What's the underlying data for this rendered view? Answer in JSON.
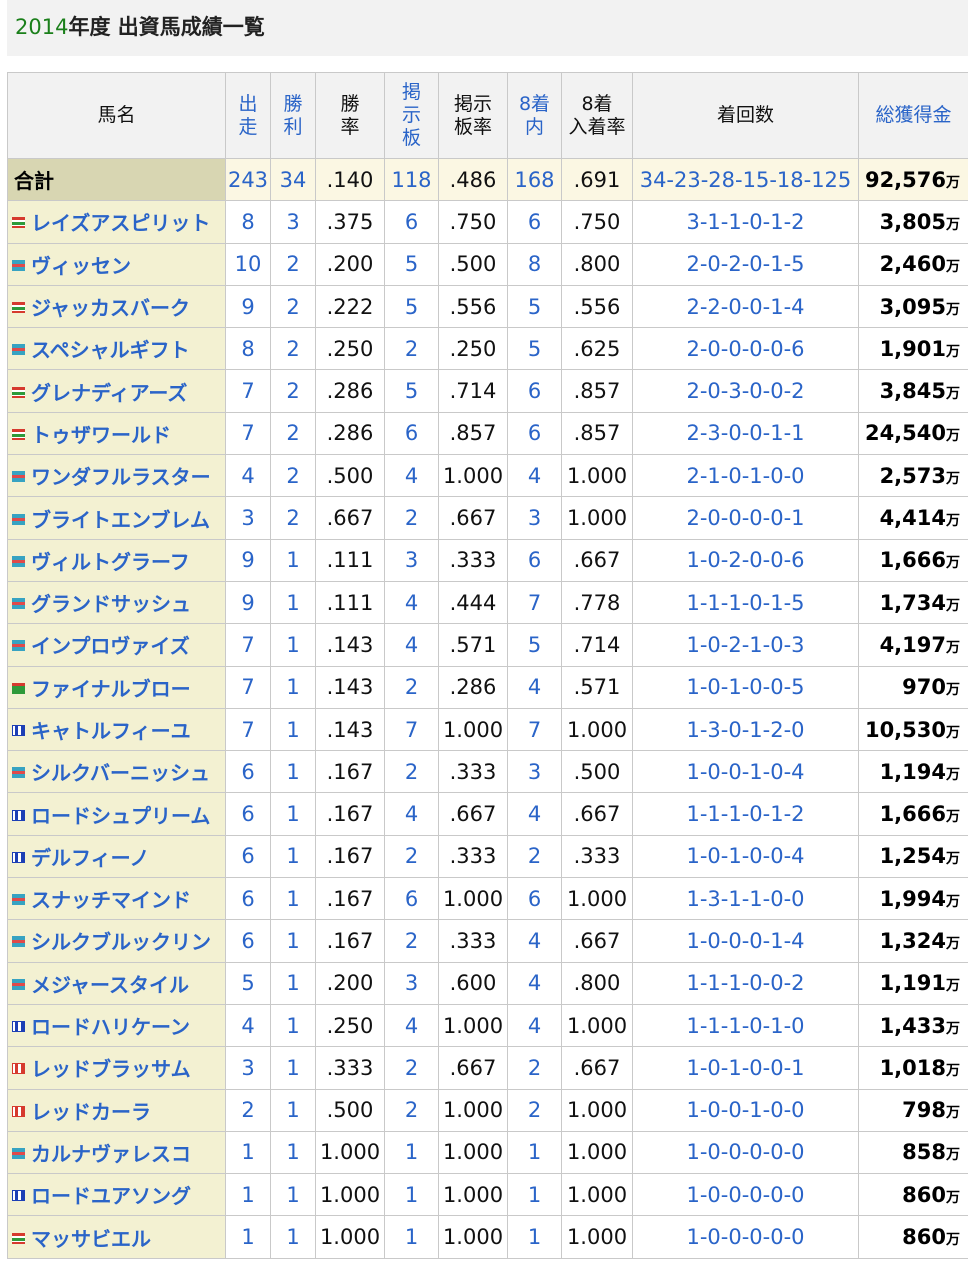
{
  "page": {
    "title_year": "2014",
    "title_rest": "年度 出資馬成績一覧"
  },
  "table": {
    "headers": {
      "name": "馬名",
      "starts": "出\n走",
      "wins": "勝\n利",
      "win_rate": "勝\n率",
      "board": "掲\n示\n板",
      "board_rate": "掲示\n板率",
      "top8": "8着\n内",
      "top8_rate": "8着\n入着率",
      "finishes": "着回数",
      "earnings": "総獲得金"
    },
    "unit": "万",
    "total": {
      "name": "合計",
      "starts": "243",
      "wins": "34",
      "win_rate": ".140",
      "board": "118",
      "board_rate": ".486",
      "top8": "168",
      "top8_rate": ".691",
      "finishes": "34-23-28-15-18-125",
      "earnings": "92,576"
    },
    "rows": [
      {
        "flag": "green-red",
        "name": "レイズアスピリット",
        "starts": "8",
        "wins": "3",
        "win_rate": ".375",
        "board": "6",
        "board_rate": ".750",
        "top8": "6",
        "top8_rate": ".750",
        "finishes": "3-1-1-0-1-2",
        "earnings": "3,805"
      },
      {
        "flag": "teal-red",
        "name": "ヴィッセン",
        "starts": "10",
        "wins": "2",
        "win_rate": ".200",
        "board": "5",
        "board_rate": ".500",
        "top8": "8",
        "top8_rate": ".800",
        "finishes": "2-0-2-0-1-5",
        "earnings": "2,460"
      },
      {
        "flag": "green-red",
        "name": "ジャッカスバーク",
        "starts": "9",
        "wins": "2",
        "win_rate": ".222",
        "board": "5",
        "board_rate": ".556",
        "top8": "5",
        "top8_rate": ".556",
        "finishes": "2-2-0-0-1-4",
        "earnings": "3,095"
      },
      {
        "flag": "teal-red",
        "name": "スペシャルギフト",
        "starts": "8",
        "wins": "2",
        "win_rate": ".250",
        "board": "2",
        "board_rate": ".250",
        "top8": "5",
        "top8_rate": ".625",
        "finishes": "2-0-0-0-0-6",
        "earnings": "1,901"
      },
      {
        "flag": "green-red",
        "name": "グレナディアーズ",
        "starts": "7",
        "wins": "2",
        "win_rate": ".286",
        "board": "5",
        "board_rate": ".714",
        "top8": "6",
        "top8_rate": ".857",
        "finishes": "2-0-3-0-0-2",
        "earnings": "3,845"
      },
      {
        "flag": "green-red",
        "name": "トゥザワールド",
        "starts": "7",
        "wins": "2",
        "win_rate": ".286",
        "board": "6",
        "board_rate": ".857",
        "top8": "6",
        "top8_rate": ".857",
        "finishes": "2-3-0-0-1-1",
        "earnings": "24,540"
      },
      {
        "flag": "teal-red",
        "name": "ワンダフルラスター",
        "starts": "4",
        "wins": "2",
        "win_rate": ".500",
        "board": "4",
        "board_rate": "1.000",
        "top8": "4",
        "top8_rate": "1.000",
        "finishes": "2-1-0-1-0-0",
        "earnings": "2,573"
      },
      {
        "flag": "teal-red",
        "name": "ブライトエンブレム",
        "starts": "3",
        "wins": "2",
        "win_rate": ".667",
        "board": "2",
        "board_rate": ".667",
        "top8": "3",
        "top8_rate": "1.000",
        "finishes": "2-0-0-0-0-1",
        "earnings": "4,414"
      },
      {
        "flag": "teal-red",
        "name": "ヴィルトグラーフ",
        "starts": "9",
        "wins": "1",
        "win_rate": ".111",
        "board": "3",
        "board_rate": ".333",
        "top8": "6",
        "top8_rate": ".667",
        "finishes": "1-0-2-0-0-6",
        "earnings": "1,666"
      },
      {
        "flag": "teal-red",
        "name": "グランドサッシュ",
        "starts": "9",
        "wins": "1",
        "win_rate": ".111",
        "board": "4",
        "board_rate": ".444",
        "top8": "7",
        "top8_rate": ".778",
        "finishes": "1-1-1-0-1-5",
        "earnings": "1,734"
      },
      {
        "flag": "teal-red",
        "name": "インプロヴァイズ",
        "starts": "7",
        "wins": "1",
        "win_rate": ".143",
        "board": "4",
        "board_rate": ".571",
        "top8": "5",
        "top8_rate": ".714",
        "finishes": "1-0-2-1-0-3",
        "earnings": "4,197"
      },
      {
        "flag": "green-cross",
        "name": "ファイナルブロー",
        "starts": "7",
        "wins": "1",
        "win_rate": ".143",
        "board": "2",
        "board_rate": ".286",
        "top8": "4",
        "top8_rate": ".571",
        "finishes": "1-0-1-0-0-5",
        "earnings": "970"
      },
      {
        "flag": "blue-stripe",
        "name": "キャトルフィーユ",
        "starts": "7",
        "wins": "1",
        "win_rate": ".143",
        "board": "7",
        "board_rate": "1.000",
        "top8": "7",
        "top8_rate": "1.000",
        "finishes": "1-3-0-1-2-0",
        "earnings": "10,530"
      },
      {
        "flag": "teal-red",
        "name": "シルクバーニッシュ",
        "starts": "6",
        "wins": "1",
        "win_rate": ".167",
        "board": "2",
        "board_rate": ".333",
        "top8": "3",
        "top8_rate": ".500",
        "finishes": "1-0-0-1-0-4",
        "earnings": "1,194"
      },
      {
        "flag": "blue-stripe",
        "name": "ロードシュプリーム",
        "starts": "6",
        "wins": "1",
        "win_rate": ".167",
        "board": "4",
        "board_rate": ".667",
        "top8": "4",
        "top8_rate": ".667",
        "finishes": "1-1-1-0-1-2",
        "earnings": "1,666"
      },
      {
        "flag": "blue-stripe",
        "name": "デルフィーノ",
        "starts": "6",
        "wins": "1",
        "win_rate": ".167",
        "board": "2",
        "board_rate": ".333",
        "top8": "2",
        "top8_rate": ".333",
        "finishes": "1-0-1-0-0-4",
        "earnings": "1,254"
      },
      {
        "flag": "teal-red",
        "name": "スナッチマインド",
        "starts": "6",
        "wins": "1",
        "win_rate": ".167",
        "board": "6",
        "board_rate": "1.000",
        "top8": "6",
        "top8_rate": "1.000",
        "finishes": "1-3-1-1-0-0",
        "earnings": "1,994"
      },
      {
        "flag": "teal-red",
        "name": "シルクブルックリン",
        "starts": "6",
        "wins": "1",
        "win_rate": ".167",
        "board": "2",
        "board_rate": ".333",
        "top8": "4",
        "top8_rate": ".667",
        "finishes": "1-0-0-0-1-4",
        "earnings": "1,324"
      },
      {
        "flag": "teal-red",
        "name": "メジャースタイル",
        "starts": "5",
        "wins": "1",
        "win_rate": ".200",
        "board": "3",
        "board_rate": ".600",
        "top8": "4",
        "top8_rate": ".800",
        "finishes": "1-1-1-0-0-2",
        "earnings": "1,191"
      },
      {
        "flag": "blue-stripe",
        "name": "ロードハリケーン",
        "starts": "4",
        "wins": "1",
        "win_rate": ".250",
        "board": "4",
        "board_rate": "1.000",
        "top8": "4",
        "top8_rate": "1.000",
        "finishes": "1-1-1-0-1-0",
        "earnings": "1,433"
      },
      {
        "flag": "red-stripe",
        "name": "レッドブラッサム",
        "starts": "3",
        "wins": "1",
        "win_rate": ".333",
        "board": "2",
        "board_rate": ".667",
        "top8": "2",
        "top8_rate": ".667",
        "finishes": "1-0-1-0-0-1",
        "earnings": "1,018"
      },
      {
        "flag": "red-stripe",
        "name": "レッドカーラ",
        "starts": "2",
        "wins": "1",
        "win_rate": ".500",
        "board": "2",
        "board_rate": "1.000",
        "top8": "2",
        "top8_rate": "1.000",
        "finishes": "1-0-0-1-0-0",
        "earnings": "798"
      },
      {
        "flag": "teal-red",
        "name": "カルナヴァレスコ",
        "starts": "1",
        "wins": "1",
        "win_rate": "1.000",
        "board": "1",
        "board_rate": "1.000",
        "top8": "1",
        "top8_rate": "1.000",
        "finishes": "1-0-0-0-0-0",
        "earnings": "858"
      },
      {
        "flag": "blue-stripe",
        "name": "ロードユアソング",
        "starts": "1",
        "wins": "1",
        "win_rate": "1.000",
        "board": "1",
        "board_rate": "1.000",
        "top8": "1",
        "top8_rate": "1.000",
        "finishes": "1-0-0-0-0-0",
        "earnings": "860"
      },
      {
        "flag": "green-red",
        "name": "マッサビエル",
        "starts": "1",
        "wins": "1",
        "win_rate": "1.000",
        "board": "1",
        "board_rate": "1.000",
        "top8": "1",
        "top8_rate": "1.000",
        "finishes": "1-0-0-0-0-0",
        "earnings": "860"
      }
    ]
  }
}
